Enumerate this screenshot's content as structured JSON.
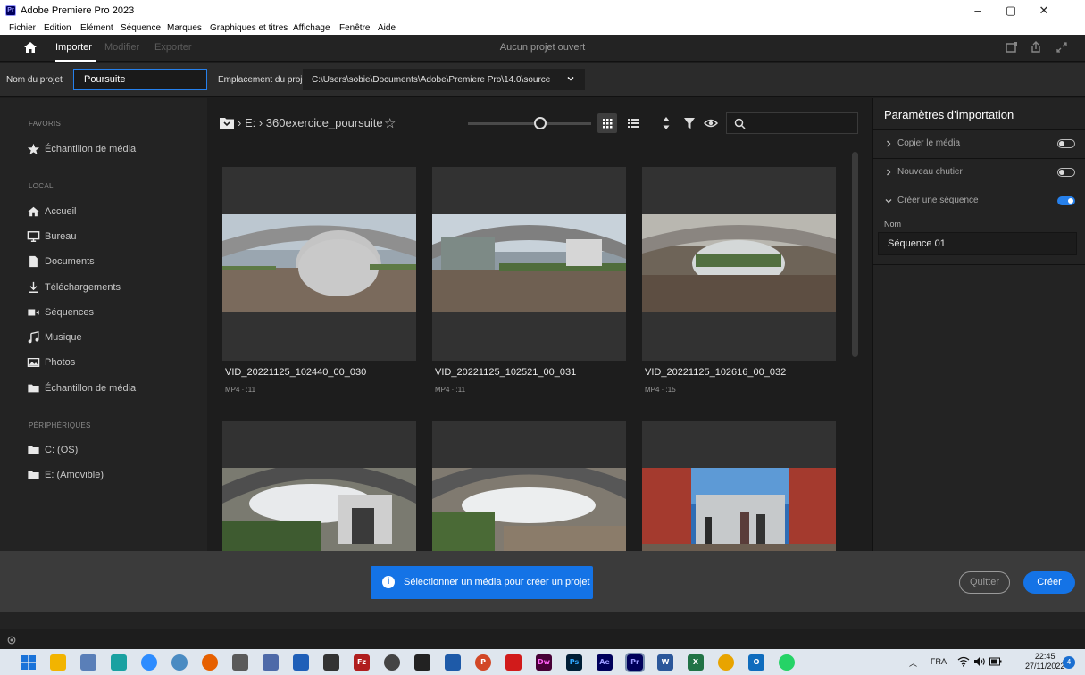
{
  "window": {
    "title": "Adobe Premiere Pro 2023",
    "app_icon": "Pr",
    "controls": [
      "–",
      "▢",
      "✕"
    ]
  },
  "menu": [
    "Fichier",
    "Edition",
    "Elément",
    "Séquence",
    "Marques",
    "Graphiques et titres",
    "Affichage",
    "Fenêtre",
    "Aide"
  ],
  "header": {
    "tabs": [
      "Importer",
      "Modifier",
      "Exporter"
    ],
    "active_tab": "Importer",
    "center": "Aucun projet ouvert"
  },
  "project": {
    "name_label": "Nom du projet",
    "name_value": "Poursuite",
    "location_label": "Emplacement du projet",
    "location_value": "C:\\Users\\sobie\\Documents\\Adobe\\Premiere Pro\\14.0\\source"
  },
  "sidebar": {
    "favoris_heading": "FAVORIS",
    "favoris": [
      {
        "label": "Échantillon de média",
        "icon": "star-icon"
      }
    ],
    "local_heading": "LOCAL",
    "local": [
      {
        "label": "Accueil",
        "icon": "home-icon"
      },
      {
        "label": "Bureau",
        "icon": "monitor-icon"
      },
      {
        "label": "Documents",
        "icon": "document-icon"
      },
      {
        "label": "Téléchargements",
        "icon": "download-icon"
      },
      {
        "label": "Séquences",
        "icon": "video-icon"
      },
      {
        "label": "Musique",
        "icon": "music-icon"
      },
      {
        "label": "Photos",
        "icon": "photo-icon"
      },
      {
        "label": "Échantillon de média",
        "icon": "folder-icon"
      }
    ],
    "devices_heading": "PÉRIPHÉRIQUES",
    "devices": [
      {
        "label": "C: (OS)",
        "icon": "folder-icon"
      },
      {
        "label": "E: (Amovible)",
        "icon": "folder-icon"
      }
    ]
  },
  "browser": {
    "breadcrumb": "› E:  ›  360exercice_poursuite",
    "zoom_level": 0.6,
    "view_mode": "grid",
    "search_placeholder": "",
    "files": [
      {
        "name": "VID_20221125_102440_00_030",
        "meta": "MP4 · :11"
      },
      {
        "name": "VID_20221125_102521_00_031",
        "meta": "MP4 · :11"
      },
      {
        "name": "VID_20221125_102616_00_032",
        "meta": "MP4 · :15"
      },
      {
        "name": "",
        "meta": ""
      },
      {
        "name": "",
        "meta": ""
      },
      {
        "name": "",
        "meta": ""
      }
    ]
  },
  "import_settings": {
    "title": "Paramètres d’importation",
    "copy_media": {
      "label": "Copier le média",
      "on": false
    },
    "new_bin": {
      "label": "Nouveau chutier",
      "on": false
    },
    "create_sequence": {
      "label": "Créer une séquence",
      "on": true
    },
    "name_label": "Nom",
    "sequence_name": "Séquence 01"
  },
  "footer": {
    "toast": "Sélectionner un média pour créer un projet",
    "quit": "Quitter",
    "create": "Créer"
  },
  "taskbar": {
    "lang": "FRA",
    "time": "22:45",
    "date": "27/11/2022",
    "notifications": "4"
  },
  "colors": {
    "accent_blue": "#1473e6",
    "input_focus": "#2680eb"
  }
}
